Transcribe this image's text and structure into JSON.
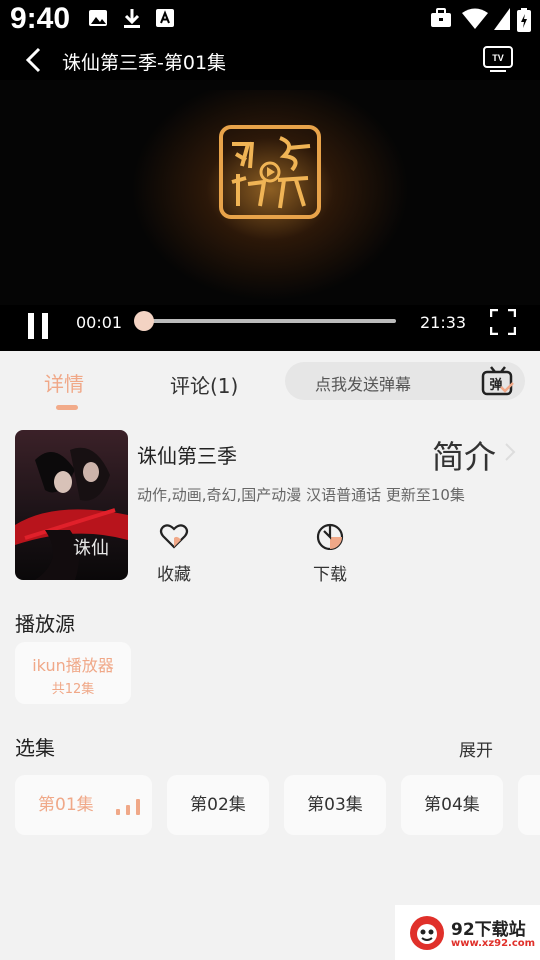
{
  "status_bar": {
    "time": "9:40"
  },
  "title_bar": {
    "title": "诛仙第三季-第01集"
  },
  "player": {
    "current_time": "00:01",
    "total_time": "21:33",
    "progress": 0.0
  },
  "tabs": {
    "detail": "详情",
    "comments": "评论(1)"
  },
  "danmu": {
    "placeholder": "点我发送弹幕",
    "icon_label": "弹"
  },
  "show": {
    "title": "诛仙第三季",
    "intro_label": "简介",
    "tags": "动作,动画,奇幻,国产动漫 汉语普通话 更新至10集",
    "poster_caption": "诛仙"
  },
  "actions": {
    "favorite": "收藏",
    "download": "下载"
  },
  "source": {
    "heading": "播放源",
    "name": "ikun播放器",
    "count": "共12集"
  },
  "episodes": {
    "heading": "选集",
    "expand": "展开",
    "items": [
      "第01集",
      "第02集",
      "第03集",
      "第04集"
    ]
  },
  "watermark": {
    "name": "92下载站",
    "url": "www.xz92.com"
  },
  "colors": {
    "accent": "#f0a888",
    "player_bg": "#050505",
    "page_bg": "#f2f2f2"
  }
}
